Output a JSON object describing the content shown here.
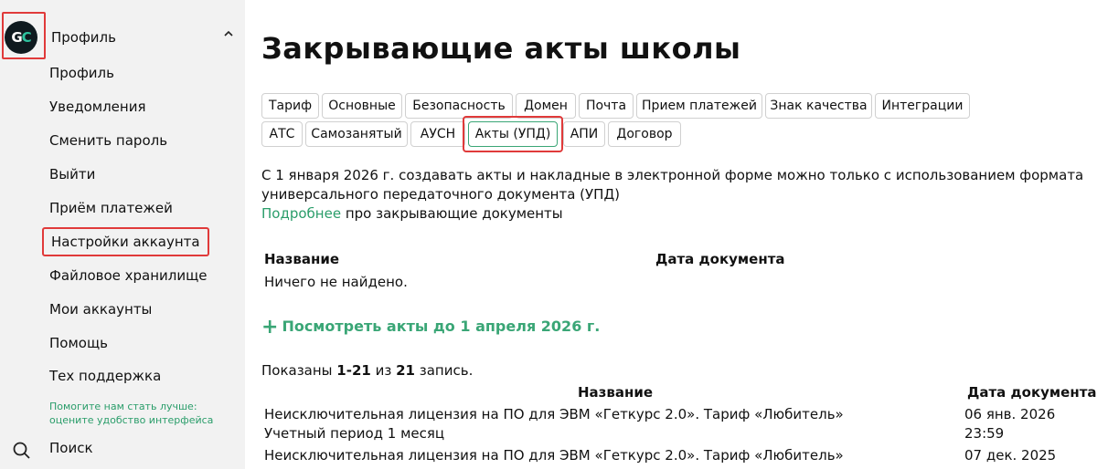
{
  "sidebar": {
    "avatar_text": "GC",
    "profile_title": "Профиль",
    "items": [
      {
        "label": "Профиль"
      },
      {
        "label": "Уведомления"
      },
      {
        "label": "Сменить пароль"
      },
      {
        "label": "Выйти"
      },
      {
        "label": "Приём платежей"
      },
      {
        "label": "Настройки аккаунта"
      },
      {
        "label": "Файловое хранилище"
      },
      {
        "label": "Мои аккаунты"
      },
      {
        "label": "Помощь"
      },
      {
        "label": "Тех поддержка"
      }
    ],
    "feedback_line1": "Помогите нам стать лучше:",
    "feedback_line2": "оцените удобство интерфейса",
    "search_label": "Поиск"
  },
  "main": {
    "title": "Закрывающие акты школы",
    "tabs_row1": [
      "Тариф",
      "Основные",
      "Безопасность",
      "Домен",
      "Почта",
      "Прием платежей",
      "Знак качества",
      "Интеграции"
    ],
    "tabs_row2": [
      "АТС",
      "Самозанятый",
      "АУСН",
      "Акты (УПД)",
      "АПИ",
      "Договор"
    ],
    "active_tab": "Акты (УПД)",
    "info_line1": "С 1 января 2026 г. создавать акты и накладные в электронной форме можно только с использованием формата",
    "info_line2": "универсального передаточного документа (УПД)",
    "info_link": "Подробнее",
    "info_link_suffix": " про закрывающие документы",
    "table1": {
      "col_name": "Название",
      "col_date": "Дата документа",
      "empty": "Ничего не найдено."
    },
    "more_link": "Посмотреть акты до 1 апреля 2026 г.",
    "shown_prefix": "Показаны ",
    "shown_range": "1-21",
    "shown_mid": " из ",
    "shown_total": "21",
    "shown_suffix": " запись.",
    "table2": {
      "col_name": "Название",
      "col_date": "Дата документа",
      "rows": [
        {
          "name_line1": "Неисключительная лицензия на ПО для ЭВМ «Геткурс 2.0». Тариф «Любитель»",
          "name_line2": "Учетный период 1 месяц",
          "date_line1": "06 янв. 2026",
          "date_line2": "23:59"
        },
        {
          "name_line1": "Неисключительная лицензия на ПО для ЭВМ «Геткурс 2.0». Тариф «Любитель»",
          "name_line2": "",
          "date_line1": "07 дек. 2025",
          "date_line2": ""
        }
      ]
    }
  },
  "colors": {
    "accent_green": "#3aa676",
    "highlight_red": "#e03a3a",
    "sidebar_bg": "#f2f2f2"
  }
}
